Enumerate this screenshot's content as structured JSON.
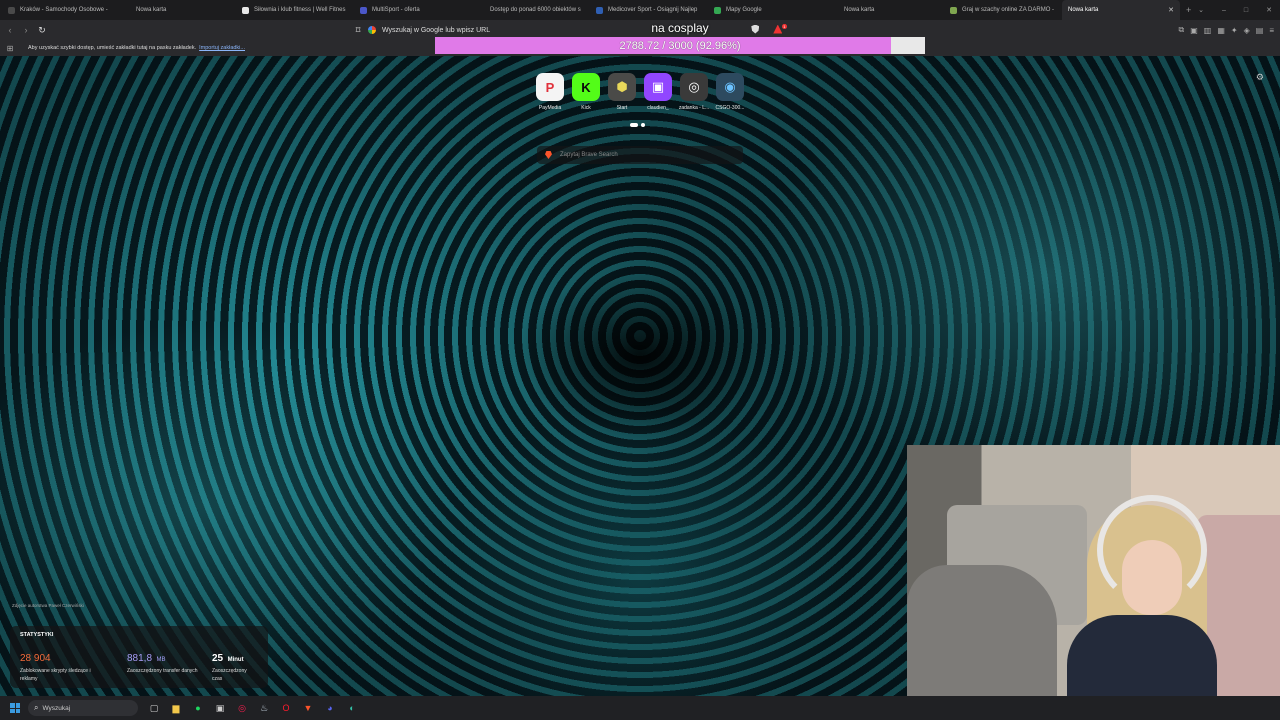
{
  "tabs": [
    {
      "title": "Kraków - Samochody Osobowe - ",
      "favicon_color": "#4a4a4a",
      "active": false
    },
    {
      "title": "Nowa karta",
      "favicon_color": "#1c1c1e",
      "active": false
    },
    {
      "title": "Siłownia i klub fitness | Well Fitnes",
      "favicon_color": "#e8e8e8",
      "active": false
    },
    {
      "title": "MultiSport - oferta",
      "favicon_color": "#4b57c9",
      "active": false
    },
    {
      "title": "Dostęp do ponad 6000 obiektów s",
      "favicon_color": "#1c1c1e",
      "active": false
    },
    {
      "title": "Medicover Sport - Osiągnij Najlep",
      "favicon_color": "#2f5fb3",
      "active": false
    },
    {
      "title": "Mapy Google",
      "favicon_color": "#34a853",
      "active": false
    },
    {
      "title": "Nowa karta",
      "favicon_color": "#1c1c1e",
      "active": false
    },
    {
      "title": "Graj w szachy online ZA DARMO -",
      "favicon_color": "#7fa650",
      "active": false
    },
    {
      "title": "Nowa karta",
      "favicon_color": "#1c1c1e",
      "active": true
    }
  ],
  "new_tab_symbol": "+",
  "window_controls": {
    "dropdown": "⌄",
    "minimize": "–",
    "maximize": "□",
    "close": "✕"
  },
  "toolbar": {
    "back": "‹",
    "forward": "›",
    "reload": "↻",
    "bookmark": "⌑",
    "address_placeholder": "Wyszukaj w Google lub wpisz URL",
    "brave_notifications": "1"
  },
  "bookmarks_bar": {
    "message": "Aby uzyskać szybki dostęp, umieść zakładki tutaj na pasku zakładek.",
    "import_link": "Importuj zakładki..."
  },
  "overlay": {
    "title": "na cosplay",
    "progress_text": "2788.72 / 3000 (92.96%)",
    "progress_fraction": 0.9296,
    "progress_color": "#e07ae8"
  },
  "top_sites": [
    {
      "label": "PayMedia",
      "glyph": "P",
      "color": "#e0313b",
      "bg": "#f4f4f4"
    },
    {
      "label": "Kick",
      "glyph": "K",
      "color": "#0b0b0b",
      "bg": "#53fc18"
    },
    {
      "label": "Start",
      "glyph": "⬢",
      "color": "#e8d85a",
      "bg": "#4a4a48"
    },
    {
      "label": "claudien_",
      "glyph": "▣",
      "color": "#ffffff",
      "bg": "#9146ff"
    },
    {
      "label": "zadanka - L...",
      "glyph": "◎",
      "color": "#ffffff",
      "bg": "#3a3a3a"
    },
    {
      "label": "CSGO-300...",
      "glyph": "◉",
      "color": "#6cc3ff",
      "bg": "#2d4a5f"
    }
  ],
  "brave_search_placeholder": "Zapytaj Brave Search",
  "photo_credit": "Zdjęcie autorstwa Paweł Czerwiński",
  "stats": {
    "header": "STATYSTYKI",
    "items": [
      {
        "value": "28 904",
        "unit": "",
        "desc": "Zablokowane skrypty śledzące i reklamy",
        "color": "#f26b3a"
      },
      {
        "value": "881,8",
        "unit": "MB",
        "desc": "Zaoszczędzony transfer danych",
        "color": "#a59cf5"
      },
      {
        "value": "25",
        "unit": "Minut",
        "desc": "Zaoszczędzony czas",
        "color": "#ffffff"
      }
    ]
  },
  "taskbar": {
    "search_label": "Wyszukaj",
    "apps": [
      {
        "name": "task-view",
        "glyph": "▢",
        "color": "#cfcfcf"
      },
      {
        "name": "file-explorer",
        "glyph": "▆",
        "color": "#f2c84b"
      },
      {
        "name": "spotify",
        "glyph": "●",
        "color": "#1ed760"
      },
      {
        "name": "store",
        "glyph": "▣",
        "color": "#cfcfcf"
      },
      {
        "name": "opera-gx",
        "glyph": "◎",
        "color": "#fa1e4e"
      },
      {
        "name": "steam",
        "glyph": "♨",
        "color": "#c7d5e0"
      },
      {
        "name": "opera",
        "glyph": "O",
        "color": "#ff1b2d"
      },
      {
        "name": "brave",
        "glyph": "▼",
        "color": "#fb542b"
      },
      {
        "name": "discord",
        "glyph": "◕",
        "color": "#5865f2"
      },
      {
        "name": "edge",
        "glyph": "◐",
        "color": "#33c1a7"
      }
    ]
  }
}
